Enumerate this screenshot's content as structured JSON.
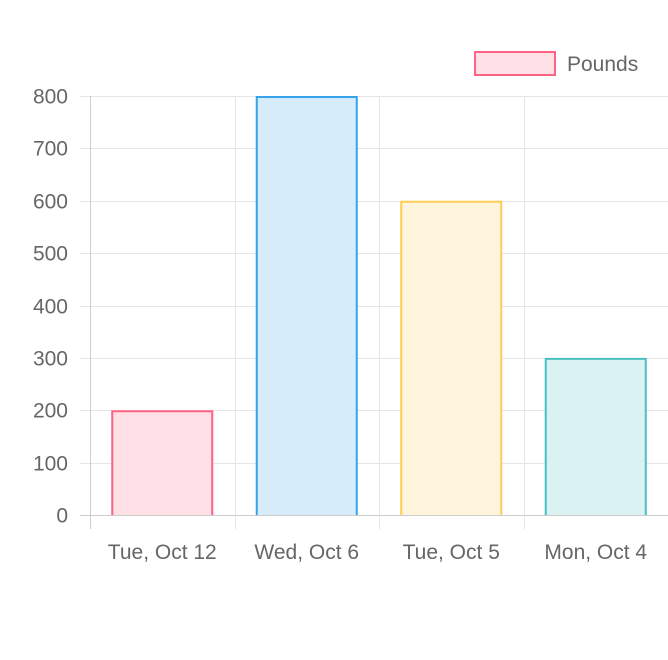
{
  "chart_data": {
    "type": "bar",
    "categories": [
      "Tue, Oct 12",
      "Wed, Oct 6",
      "Tue, Oct 5",
      "Mon, Oct 4"
    ],
    "series": [
      {
        "name": "Pounds",
        "values": [
          200,
          800,
          600,
          300
        ]
      }
    ],
    "ylim": [
      0,
      800
    ],
    "yticks": [
      0,
      100,
      200,
      300,
      400,
      500,
      600,
      700,
      800
    ],
    "grid": true,
    "legend_position": "top-right",
    "colors": {
      "bar_fills": [
        "#ffe0e6",
        "#d7ecfb",
        "#fff5dd",
        "#dbf2f2"
      ],
      "bar_borders": [
        "#ff6384",
        "#36a2eb",
        "#ffcd56",
        "#4bc0c0"
      ],
      "legend_fill": "#ffe0e6",
      "legend_border": "#ff6384",
      "grid": "#e5e5e5",
      "axis": "#cccccc",
      "text": "#666666"
    }
  }
}
